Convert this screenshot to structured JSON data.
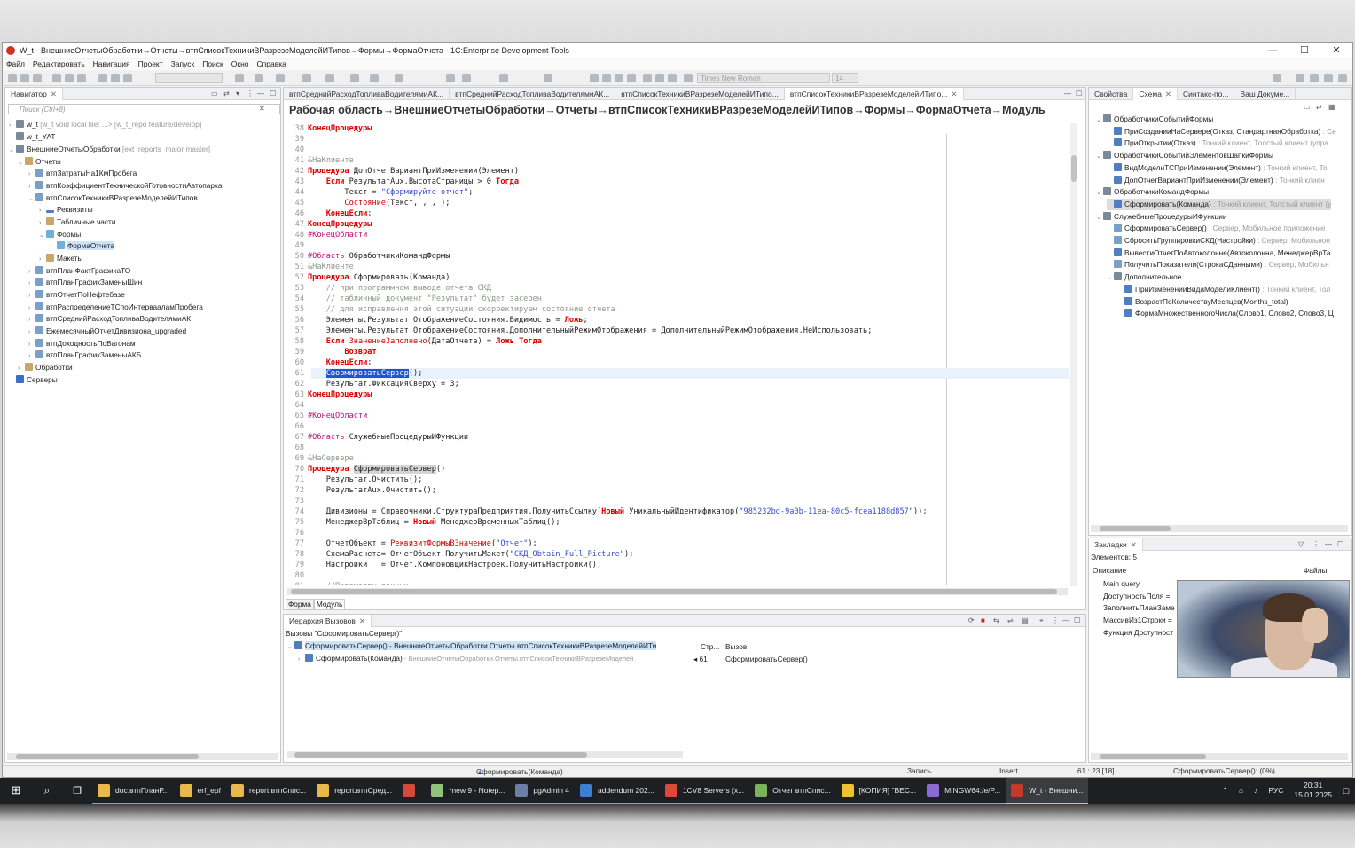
{
  "window": {
    "title": "W_t - ВнешниеОтчетыОбработки→Отчеты→втпСписокТехникиВРазрезеМоделейИТипов→Формы→ФормаОтчета - 1C:Enterprise Development Tools",
    "minimize": "—",
    "maximize": "☐",
    "close": "✕"
  },
  "menu": [
    "Файл",
    "Редактировать",
    "Навигация",
    "Проект",
    "Запуск",
    "Поиск",
    "Окно",
    "Справка"
  ],
  "toolbar": {
    "font_name": "Times New Roman",
    "font_size": "14"
  },
  "navigator": {
    "tab": "Навигатор",
    "search_placeholder": "Поиск (Ctrl+8)",
    "items": [
      {
        "label": "w_t",
        "suffix": "[w_t void local file: ...> [w_t_repo feature/develop]"
      },
      {
        "label": "w_t_YAT",
        "suffix": ""
      },
      {
        "label": "ВнешниеОтчетыОбработки",
        "suffix": "[ext_reports_major master]"
      },
      {
        "label": "Отчеты",
        "suffix": ""
      },
      {
        "label": "втпЗатратыНа1КмПробега",
        "suffix": ""
      },
      {
        "label": "втпКоэффициентТехническойГотовностиАвтопарка",
        "suffix": ""
      },
      {
        "label": "втпСписокТехникиВРазрезеМоделейИТипов",
        "suffix": ""
      },
      {
        "label": "Реквизиты",
        "suffix": ""
      },
      {
        "label": "Табличные части",
        "suffix": ""
      },
      {
        "label": "Формы",
        "suffix": ""
      },
      {
        "label": "ФормаОтчета",
        "suffix": ""
      },
      {
        "label": "Макеты",
        "suffix": ""
      },
      {
        "label": "втпПланФактГрафикаТО",
        "suffix": ""
      },
      {
        "label": "втпПланГрафикЗаменыШин",
        "suffix": ""
      },
      {
        "label": "втпОтчетПоНефтебазе",
        "suffix": ""
      },
      {
        "label": "втпРаспределениеТСпоИнтервааламПробега",
        "suffix": ""
      },
      {
        "label": "втпСреднийРасходТопливаВодителямиАК",
        "suffix": ""
      },
      {
        "label": "ЕжемесячныйОтчетДивизиона_upgraded",
        "suffix": ""
      },
      {
        "label": "втпДоходностьПоВагонам",
        "suffix": ""
      },
      {
        "label": "втпПланГрафикЗаменыАКБ",
        "suffix": ""
      },
      {
        "label": "Обработки",
        "suffix": ""
      },
      {
        "label": "Серверы",
        "suffix": ""
      }
    ]
  },
  "editor": {
    "tabs": [
      "втпСреднийРасходТопливаВодителямиАК...",
      "втпСреднийРасходТопливаВодителямиАК...",
      "втпСписокТехникиВРазрезеМоделейИТипо...",
      "втпСписокТехникиВРазрезеМоделейИТипо..."
    ],
    "title": "Рабочая область→ВнешниеОтчетыОбработки→Отчеты→втпСписокТехникиВРазрезеМоделейИТипов→Формы→ФормаОтчета→Модуль",
    "bottom_tabs": [
      "Форма",
      "Модуль"
    ],
    "lines": [
      {
        "n": "38",
        "html": "<span class='kw'>КонецПроцедуры</span>"
      },
      {
        "n": "39",
        "html": ""
      },
      {
        "n": "40",
        "html": ""
      },
      {
        "n": "41",
        "html": "<span class='cm'>&amp;НаКлиенте</span>"
      },
      {
        "n": "42",
        "html": "<span class='kw'>Процедура</span> ДопОтчетВариантПриИзменении(Элемент)"
      },
      {
        "n": "43",
        "html": "    <span class='kw'>Если</span> РезультатAux.ВысотаСтраницы &gt; 0 <span class='kw'>Тогда</span>"
      },
      {
        "n": "44",
        "html": "        Текст = <span class='str'>\"Сформируйте отчет\"</span>;"
      },
      {
        "n": "45",
        "html": "        <span class='kwr'>Состояние</span>(Текст, , , );"
      },
      {
        "n": "46",
        "html": "    <span class='kw'>КонецЕсли</span>;"
      },
      {
        "n": "47",
        "html": "<span class='kw'>КонецПроцедуры</span>"
      },
      {
        "n": "48",
        "html": "<span class='dir'>#КонецОбласти</span>"
      },
      {
        "n": "49",
        "html": ""
      },
      {
        "n": "50",
        "html": "<span class='dir'>#Область</span> ОбработчикиКомандФормы"
      },
      {
        "n": "51",
        "html": "<span class='cm'>&amp;НаКлиенте</span>"
      },
      {
        "n": "52",
        "html": "<span class='kw'>Процедура</span> Сформировать(Команда)"
      },
      {
        "n": "53",
        "html": "    <span class='cm'>// при программном выводе отчета СКД</span>"
      },
      {
        "n": "54",
        "html": "    <span class='cm'>// табличный документ \"Результат\" будет засерен</span>"
      },
      {
        "n": "55",
        "html": "    <span class='cm'>// для исправления этой ситуации скорректируем состояние отчета</span>"
      },
      {
        "n": "56",
        "html": "    Элементы.Результат.ОтображениеСостояния.Видимость = <span class='kw'>Ложь</span>;"
      },
      {
        "n": "57",
        "html": "    Элементы.Результат.ОтображениеСостояния.ДополнительныйРежимОтображения = ДополнительныйРежимОтображения.НеИспользовать;"
      },
      {
        "n": "58",
        "html": "    <span class='kw'>Если</span> <span class='kwr'>ЗначениеЗаполнено</span>(ДатаОтчета) = <span class='kw'>Ложь</span> <span class='kw'>Тогда</span>"
      },
      {
        "n": "59",
        "html": "        <span class='kw'>Возврат</span>"
      },
      {
        "n": "60",
        "html": "    <span class='kw'>КонецЕсли</span>;"
      },
      {
        "n": "61",
        "html": "    <span class='hl-sel'>СформироватьСервер</span>();"
      },
      {
        "n": "62",
        "html": "    Результат.ФиксацияСверху = 3;"
      },
      {
        "n": "63",
        "html": "<span class='kw'>КонецПроцедуры</span>"
      },
      {
        "n": "64",
        "html": ""
      },
      {
        "n": "65",
        "html": "<span class='dir'>#КонецОбласти</span>"
      },
      {
        "n": "66",
        "html": ""
      },
      {
        "n": "67",
        "html": "<span class='dir'>#Область</span> СлужебныеПроцедурыИФункции"
      },
      {
        "n": "68",
        "html": ""
      },
      {
        "n": "69",
        "html": "<span class='cm'>&amp;НаСервере</span>"
      },
      {
        "n": "70",
        "html": "<span class='kw'>Процедура</span> <span class='hl-occ'>СформироватьСервер</span>()"
      },
      {
        "n": "71",
        "html": "    Результат.Очистить();"
      },
      {
        "n": "72",
        "html": "    РезультатAux.Очистить();"
      },
      {
        "n": "73",
        "html": ""
      },
      {
        "n": "74",
        "html": "    Дивизионы = Справочники.СтруктураПредприятия.ПолучитьСсылку(<span class='kw'>Новый</span> УникальныйИдентификатор(<span class='str'>\"985232bd-9a0b-11ea-80c5-fcea1188d857\"</span>));"
      },
      {
        "n": "75",
        "html": "    МенеджерВрТаблиц = <span class='kw'>Новый</span> МенеджерВременныхТаблиц();"
      },
      {
        "n": "76",
        "html": ""
      },
      {
        "n": "77",
        "html": "    ОтчетОбъект = <span class='kwr'>РеквизитФормыВЗначение</span>(<span class='str'>\"Отчет\"</span>);"
      },
      {
        "n": "78",
        "html": "    СхемаРасчета= ОтчетОбъект.ПолучитьМакет(<span class='str'>\"СКД_Obtain_Full_Picture\"</span>);"
      },
      {
        "n": "79",
        "html": "    Настройки   = Отчет.КомпоновщикНастроек.ПолучитьНастройки();"
      },
      {
        "n": "80",
        "html": ""
      },
      {
        "n": "81",
        "html": "    <span class='cm'>//Параметры данных</span>"
      }
    ]
  },
  "outline": {
    "tabs": [
      "Свойства",
      "Схема",
      "Синтакс-по...",
      "Ваш Докуме..."
    ],
    "items": [
      {
        "label": "ОбработчикиСобытийФормы",
        "detail": "",
        "level": 0
      },
      {
        "label": "ПриСозданииНаСервере(Отказ, СтандартнаяОбработка)",
        "detail": " : Се",
        "level": 1
      },
      {
        "label": "ПриОткрытии(Отказ)",
        "detail": " : Тонкий клиент, Толстый клиент (упра",
        "level": 1
      },
      {
        "label": "ОбработчикиСобытийЭлементовШапкиФормы",
        "detail": "",
        "level": 0
      },
      {
        "label": "ВидМоделиТСПриИзменении(Элемент)",
        "detail": " : Тонкий клиент, То",
        "level": 1
      },
      {
        "label": "ДопОтчетВариантПриИзменении(Элемент)",
        "detail": " : Тонкий клиен",
        "level": 1
      },
      {
        "label": "ОбработчикиКомандФормы",
        "detail": "",
        "level": 0
      },
      {
        "label": "Сформировать(Команда)",
        "detail": " : Тонкий клиент, Толстый клиент (у",
        "level": 1
      },
      {
        "label": "СлужебныеПроцедурыИФункции",
        "detail": "",
        "level": 0
      },
      {
        "label": "СформироватьСервер()",
        "detail": " : Сервер, Мобильное приложение",
        "level": 1
      },
      {
        "label": "СброситьГруппировкиСКД(Настройки)",
        "detail": " : Сервер, Мобильное",
        "level": 1
      },
      {
        "label": "ВывестиОтчетПоАвтоколонне(Автоколонна, МенеджерВрТа",
        "detail": "",
        "level": 1
      },
      {
        "label": "ПолучитьПоказатели(СтрокаСДанными)",
        "detail": " : Сервер, Мобильн",
        "level": 1
      },
      {
        "label": "Дополнительное",
        "detail": "",
        "level": 1
      },
      {
        "label": "ПриИзмененииВидаМоделиКлиент()",
        "detail": " : Тонкий клиент, Тол",
        "level": 2
      },
      {
        "label": "ВозрастПоКоличествуМесяцев(Months_total)",
        "detail": "",
        "level": 2
      },
      {
        "label": "ФормаМножественногоЧисла(Слово1, Слово2, Слово3, Ц",
        "detail": "",
        "level": 2
      }
    ]
  },
  "bookmarks": {
    "tab": "Закладки",
    "count": "Элементов: 5",
    "col_desc": "Описание",
    "col_files": "Файлы",
    "items": [
      "Main query",
      "ДоступностьПоля =",
      "ЗаполнитьПланЗаме",
      "МассивИз1Строки =",
      "Функция Доступност"
    ]
  },
  "hierarchy": {
    "tab": "Иерархия Вызовов",
    "caption": "Вызовы \"СформироватьСервер()\"",
    "row1": "СформироватьСервер() - ВнешниеОтчетыОбработки.Отчеты.втпСписокТехникиВРазрезеМоделейИТи",
    "row2_label": "Сформировать(Команда)",
    "row2_path": " - ВнешниеОтчетыОбработки.Отчеты.втпСписокТехникиВРазрезеМоделей",
    "col_line": "Стр...",
    "col_call": "Вызов",
    "call_line": "61",
    "call_text": "СформироватьСервер()"
  },
  "status": {
    "left": "Сформировать(Команда)",
    "mode": "Запись",
    "insert": "Insert",
    "pos": "61 : 23 [18]",
    "right": "СформироватьСервер(): (0%)"
  },
  "taskbar": {
    "items": [
      {
        "label": "doc.втпПланР...",
        "color": "#e8b84a"
      },
      {
        "label": "erf_epf",
        "color": "#e8b84a"
      },
      {
        "label": "report.втпСпис...",
        "color": "#e8b84a"
      },
      {
        "label": "report.втпСред...",
        "color": "#e8b84a"
      },
      {
        "label": "",
        "color": "#d44a3a"
      },
      {
        "label": "*new 9 - Notep...",
        "color": "#8fc27a"
      },
      {
        "label": "pgAdmin 4",
        "color": "#6a7ea8"
      },
      {
        "label": "addendum 202...",
        "color": "#3f7fd0"
      },
      {
        "label": "1CV8 Servers (x...",
        "color": "#d94a3a"
      },
      {
        "label": "Отчет втпСпис...",
        "color": "#7bb25a"
      },
      {
        "label": "[КОПИЯ] \"ВЕС...",
        "color": "#f0c030"
      },
      {
        "label": "MINGW64:/e/P...",
        "color": "#8a6cd0"
      },
      {
        "label": "W_t - Внешни...",
        "color": "#c43a2a"
      }
    ],
    "lang": "РУС",
    "time": "20:31",
    "date": "15.01.2025"
  }
}
